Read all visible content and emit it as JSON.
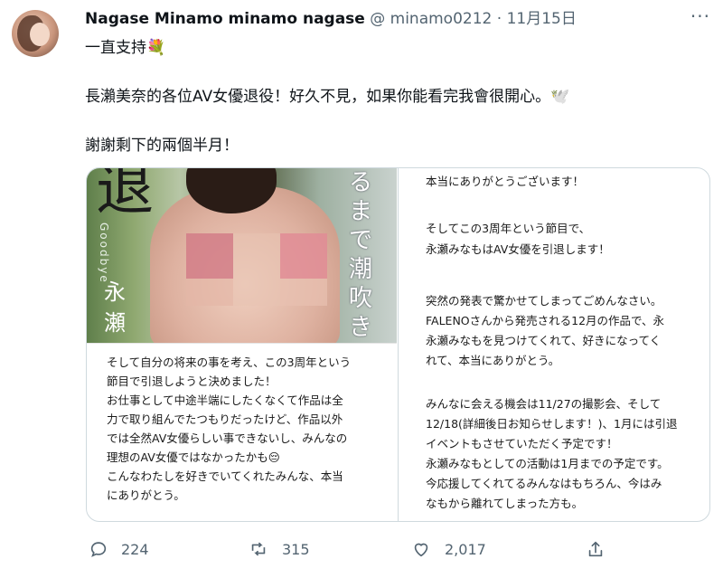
{
  "tweet": {
    "author_name": "Nagase Minamo minamo nagase",
    "handle": "@ minamo0212",
    "separator": "·",
    "date": "11月15日",
    "more": "···",
    "lines": [
      "一直支持💐",
      "長瀨美奈的各位AV女優退役！好久不見，如果你能看完我會很開心。🕊️",
      "謝謝剩下的兩個半月！"
    ]
  },
  "media": {
    "photo_text": {
      "big_char": "退",
      "goodbye": "Goodbye",
      "vertical_name": "永瀬",
      "vertical_text": "るまで潮吹き"
    },
    "left_caption": [
      "そして自分の将来の事を考え、この3周年という",
      "節目で引退しようと決めました！",
      "お仕事として中途半端にしたくなくて作品は全",
      "力で取り組んでたつもりだったけど、作品以外",
      "では全然AV女優らしい事できないし、みんなの",
      "理想のAV女優ではなかったかも😔",
      "こんなわたしを好きでいてくれたみんな、本当",
      "にありがとう。"
    ],
    "right_caption": [
      "本当にありがとうございます！",
      "そしてこの3周年という節目で、",
      "永瀬みなもはAV女優を引退します！",
      "突然の発表で驚かせてしまってごめんなさい。",
      "FALENOさんから発売される12月の作品で、永",
      "永瀬みなもを見つけてくれて、好きになってく",
      "れて、本当にありがとう。",
      "みんなに会える機会は11/27の撮影会、そして",
      "12/18(詳細後日お知らせします！)、1月には引退",
      "イベントもさせていただく予定です！",
      "永瀬みなもとしての活動は1月までの予定です。",
      "今応援してくれてるみんなはもちろん、今はみ",
      "なもから離れてしまった方も。"
    ]
  },
  "actions": {
    "replies": "224",
    "retweets": "315",
    "likes": "2,017"
  }
}
